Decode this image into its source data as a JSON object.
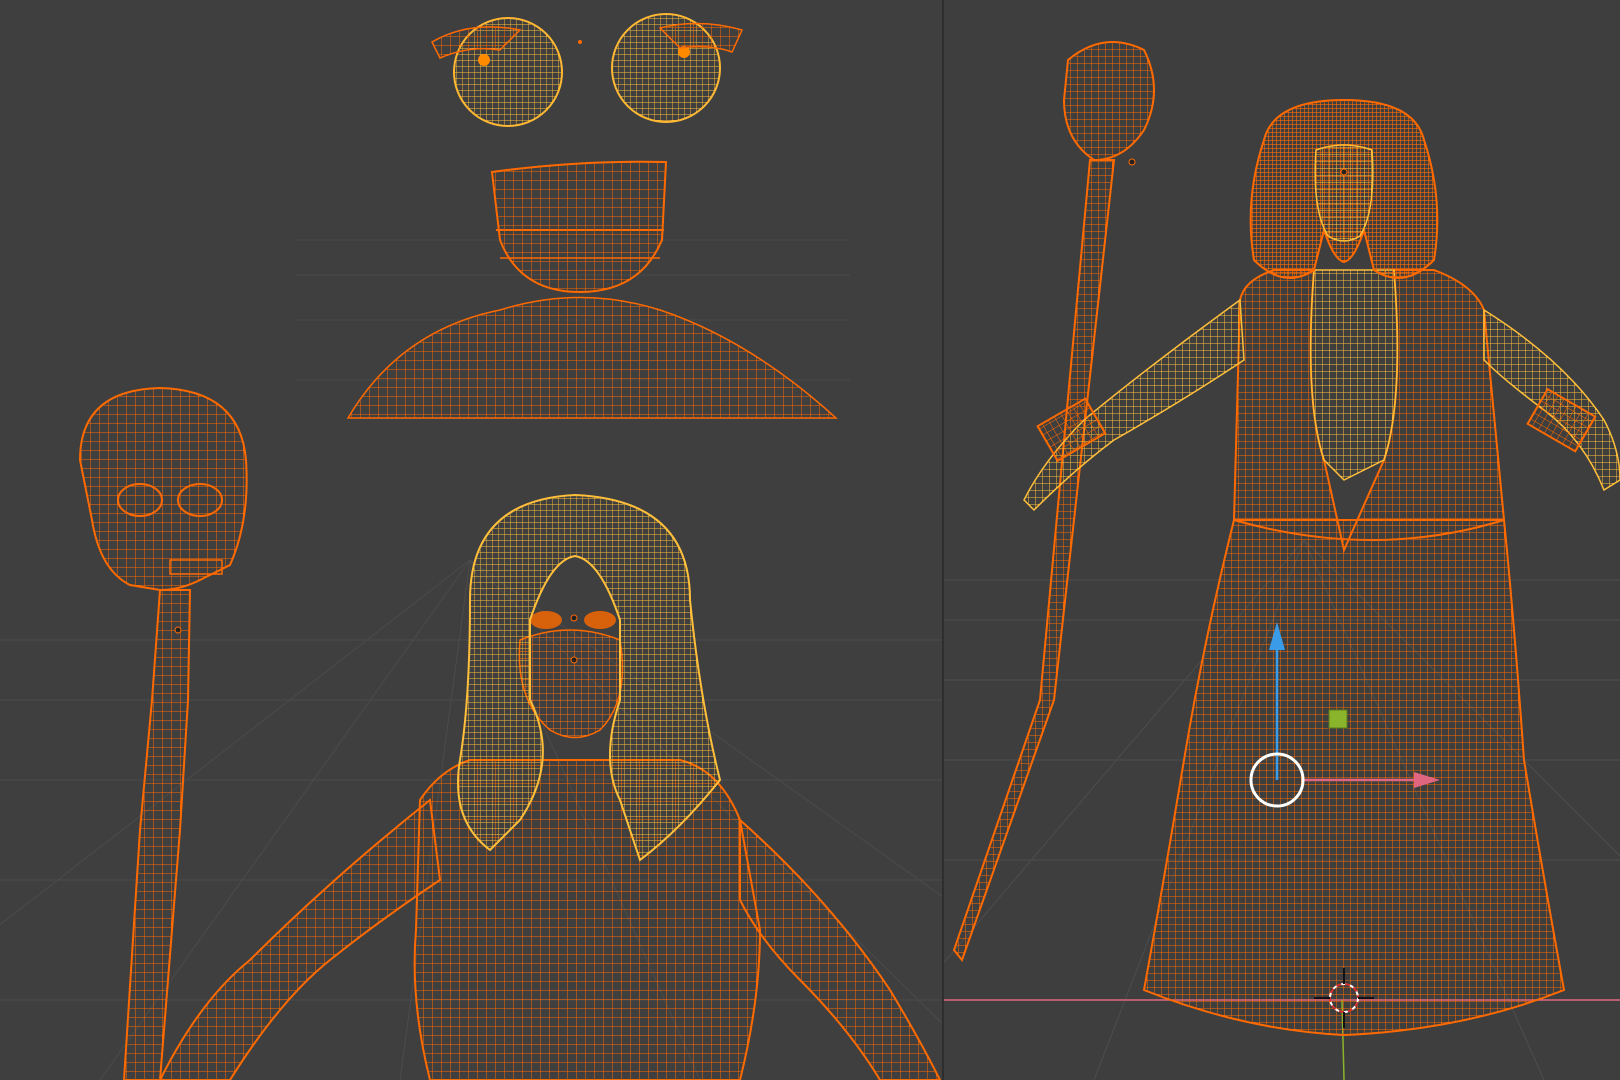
{
  "app": {
    "name": "",
    "mode": "wireframe"
  },
  "viewports": {
    "left": {
      "name": "viewport-left",
      "shading": "wireframe"
    },
    "right": {
      "name": "viewport-right",
      "shading": "wireframe"
    }
  },
  "colors": {
    "background": "#3f3f3f",
    "grid": "#4a4a4a",
    "wire_selected": "#ff6a00",
    "wire_active": "#ffb833",
    "axis_x": "#e06680",
    "axis_z": "#3a9be8",
    "gizmo_green": "#8ab42c"
  },
  "objects": [
    {
      "name": "eyes",
      "icon": "eye-mesh-icon"
    },
    {
      "name": "teeth",
      "icon": "teeth-mesh-icon"
    },
    {
      "name": "skull-staff",
      "icon": "staff-mesh-icon"
    },
    {
      "name": "character-body",
      "icon": "body-mesh-icon"
    },
    {
      "name": "hair",
      "icon": "hair-mesh-icon"
    }
  ],
  "gizmo": {
    "type": "move",
    "icon": "transform-gizmo-icon"
  },
  "cursor": {
    "icon": "3d-cursor-icon"
  }
}
